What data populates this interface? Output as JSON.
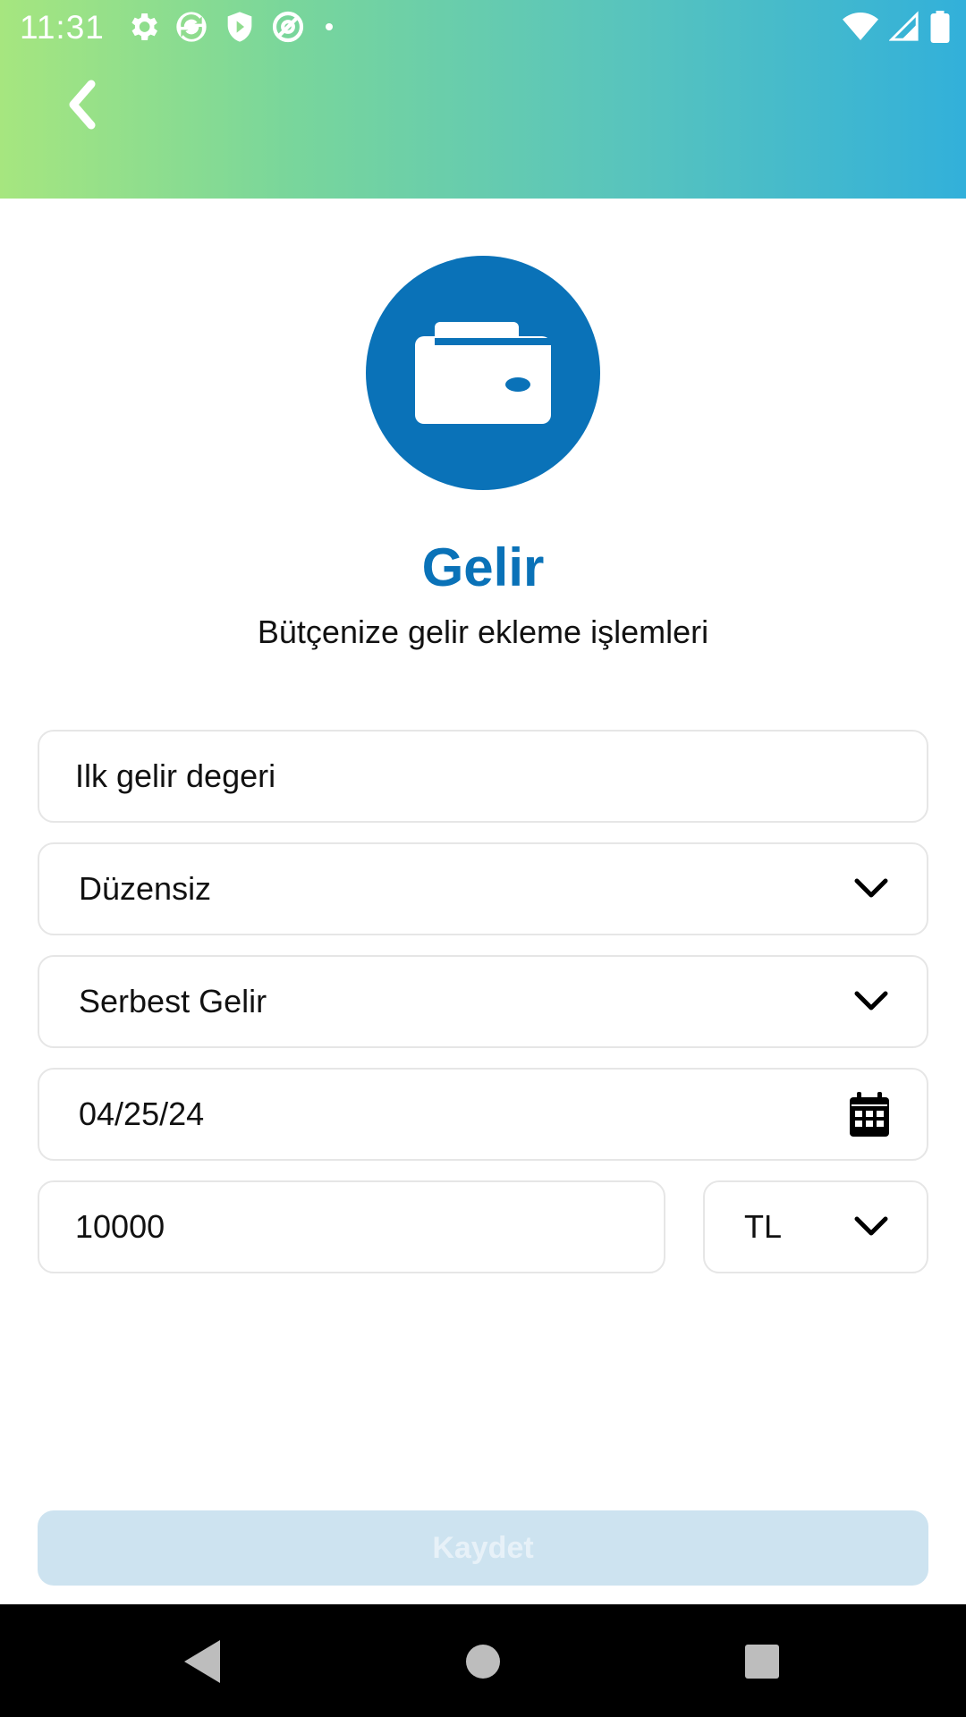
{
  "status_bar": {
    "time": "11:31",
    "left_icons": [
      "settings-icon",
      "sync-icon",
      "shield-icon",
      "at-sign-icon",
      "dot-icon"
    ],
    "right_icons": [
      "wifi-icon",
      "cellular-icon",
      "battery-icon"
    ]
  },
  "header": {
    "gradient_colors": [
      "#a6e67f",
      "#32b0da"
    ],
    "back_icon": "chevron-left-icon"
  },
  "hero": {
    "icon": "wallet-icon",
    "circle_color": "#0a72b8",
    "title": "Gelir",
    "subtitle": "Bütçenize gelir ekleme işlemleri"
  },
  "form": {
    "description_value": "Ilk gelir degeri",
    "frequency_value": "Düzensiz",
    "category_value": "Serbest Gelir",
    "date_value": "04/25/24",
    "amount_value": "10000",
    "currency_value": "TL"
  },
  "actions": {
    "save_label": "Kaydet",
    "save_color": "#cde3f0"
  },
  "nav": {
    "icons": [
      "back-triangle-icon",
      "home-circle-icon",
      "recents-square-icon"
    ]
  }
}
